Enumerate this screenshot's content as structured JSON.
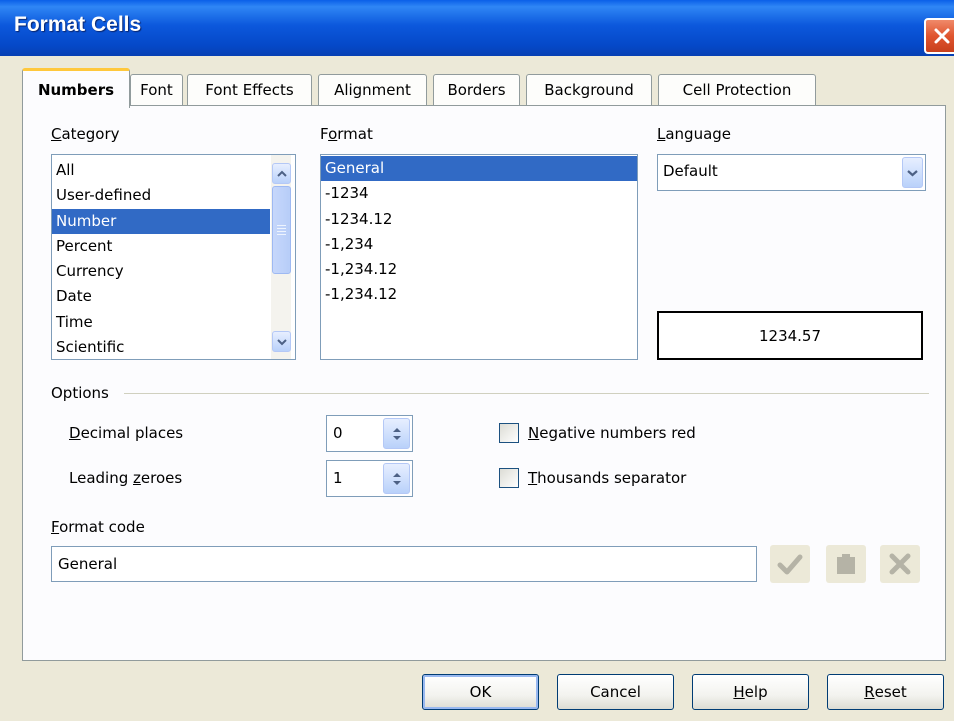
{
  "window": {
    "title": "Format Cells"
  },
  "tabs": [
    {
      "label": "Numbers",
      "active": true
    },
    {
      "label": "Font"
    },
    {
      "label": "Font Effects"
    },
    {
      "label": "Alignment"
    },
    {
      "label": "Borders"
    },
    {
      "label": "Background"
    },
    {
      "label": "Cell Protection"
    }
  ],
  "category": {
    "label": "Category",
    "items": [
      "All",
      "User-defined",
      "Number",
      "Percent",
      "Currency",
      "Date",
      "Time",
      "Scientific"
    ],
    "selected": "Number"
  },
  "format": {
    "label": "Format",
    "items": [
      "General",
      "-1234",
      "-1234.12",
      "-1,234",
      "-1,234.12",
      "-1,234.12"
    ],
    "selected": "General"
  },
  "language": {
    "label": "Language",
    "value": "Default"
  },
  "preview": {
    "value": "1234.57"
  },
  "options": {
    "label": "Options",
    "decimal_places": {
      "label": "Decimal places",
      "value": "0"
    },
    "leading_zeroes": {
      "label": "Leading zeroes",
      "value": "1"
    },
    "negative_red": {
      "label": "Negative numbers red",
      "checked": false
    },
    "thousands_sep": {
      "label": "Thousands separator",
      "checked": false
    }
  },
  "format_code": {
    "label": "Format code",
    "value": "General"
  },
  "buttons": {
    "ok": "OK",
    "cancel": "Cancel",
    "help": "Help",
    "reset": "Reset"
  },
  "colors": {
    "titlebar": "#0a5fe8",
    "selection": "#316ac5",
    "dialog_bg": "#ece9d8",
    "tab_highlight": "#ffc83c"
  }
}
